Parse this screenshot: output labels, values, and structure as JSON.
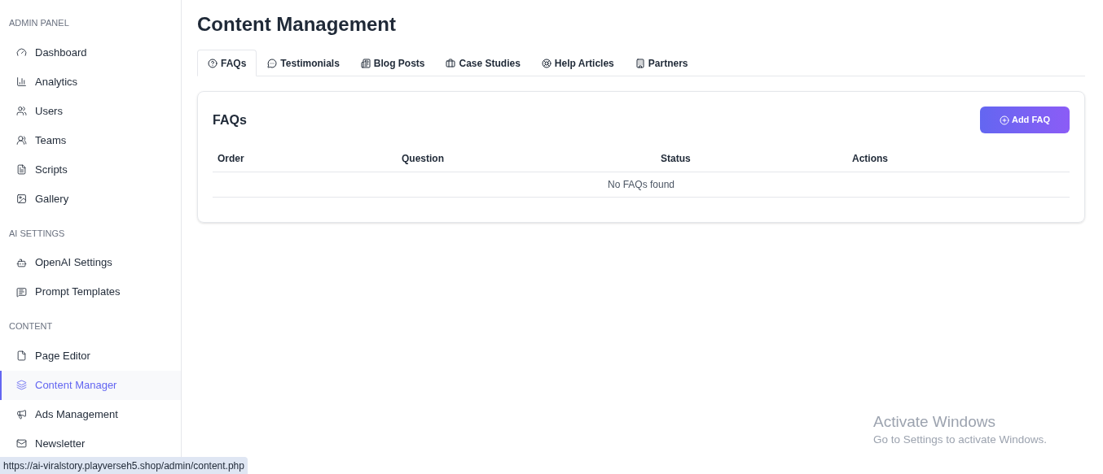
{
  "sidebar": {
    "sections": [
      {
        "heading": "ADMIN PANEL",
        "items": [
          {
            "label": "Dashboard",
            "selected": false
          },
          {
            "label": "Analytics",
            "selected": false
          },
          {
            "label": "Users",
            "selected": false
          },
          {
            "label": "Teams",
            "selected": false
          },
          {
            "label": "Scripts",
            "selected": false
          },
          {
            "label": "Gallery",
            "selected": false
          }
        ]
      },
      {
        "heading": "AI SETTINGS",
        "items": [
          {
            "label": "OpenAI Settings",
            "selected": false
          },
          {
            "label": "Prompt Templates",
            "selected": false
          }
        ]
      },
      {
        "heading": "CONTENT",
        "items": [
          {
            "label": "Page Editor",
            "selected": false
          },
          {
            "label": "Content Manager",
            "selected": true
          },
          {
            "label": "Ads Management",
            "selected": false
          },
          {
            "label": "Newsletter",
            "selected": false
          }
        ]
      }
    ]
  },
  "page_title": "Content Management",
  "tabs": [
    {
      "label": "FAQs",
      "selected": true
    },
    {
      "label": "Testimonials",
      "selected": false
    },
    {
      "label": "Blog Posts",
      "selected": false
    },
    {
      "label": "Case Studies",
      "selected": false
    },
    {
      "label": "Help Articles",
      "selected": false
    },
    {
      "label": "Partners",
      "selected": false
    }
  ],
  "card": {
    "title": "FAQs",
    "add_button": "Add FAQ",
    "table": {
      "columns": [
        "Order",
        "Question",
        "Status",
        "Actions"
      ],
      "empty_message": "No FAQs found"
    }
  },
  "status_url": "https://ai-viralstory.playverseh5.shop/admin/content.php",
  "os_notice": {
    "title": "Activate Windows",
    "subtitle": "Go to Settings to activate Windows."
  }
}
